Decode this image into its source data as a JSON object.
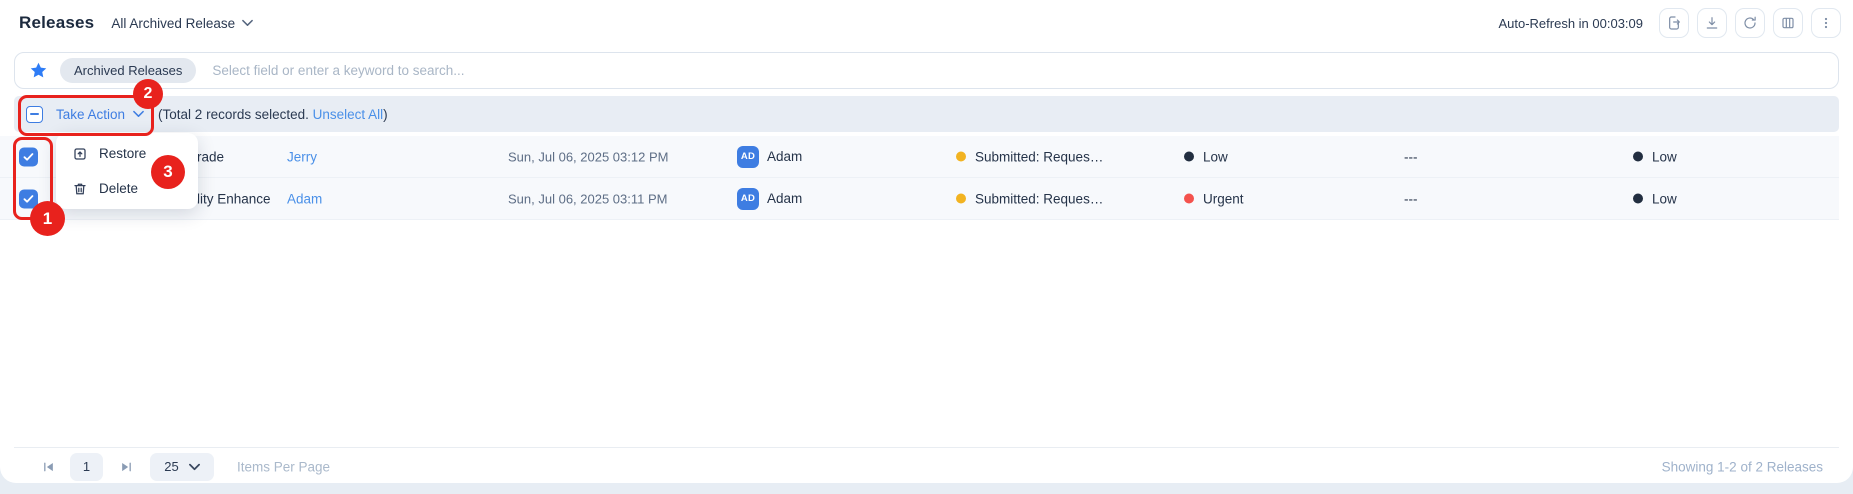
{
  "header": {
    "title": "Releases",
    "view_selector": "All Archived Release",
    "auto_refresh": "Auto-Refresh in 00:03:09",
    "toolbar_icons": [
      "export-icon",
      "download-icon",
      "refresh-icon",
      "columns-icon",
      "kebab-menu-icon"
    ]
  },
  "search": {
    "star_icon": "favorite-star-icon",
    "chip": "Archived Releases",
    "placeholder": "Select field or enter a keyword to search..."
  },
  "action_bar": {
    "take_action_label": "Take Action",
    "selection_prefix": "(Total 2 records selected. ",
    "unselect_all": "Unselect All",
    "selection_suffix": ")"
  },
  "menu": {
    "items": [
      {
        "label": "Restore",
        "icon": "restore-icon"
      },
      {
        "label": "Delete",
        "icon": "trash-icon"
      }
    ]
  },
  "table": {
    "rows": [
      {
        "name_fragment": "rade",
        "requester": "Jerry",
        "date": "Sun, Jul 06, 2025 03:12 PM",
        "assignee_initials": "AD",
        "assignee": "Adam",
        "status": "Submitted: Reques…",
        "status_color": "#f2b321",
        "priority": "Low",
        "priority_color": "#222e40",
        "placeholder_value": "---",
        "risk": "Low",
        "risk_color": "#222e40"
      },
      {
        "name_fragment": "lity Enhance",
        "requester": "Adam",
        "date": "Sun, Jul 06, 2025 03:11 PM",
        "assignee_initials": "AD",
        "assignee": "Adam",
        "status": "Submitted: Reques…",
        "status_color": "#f2b321",
        "priority": "Urgent",
        "priority_color": "#f4524d",
        "placeholder_value": "---",
        "risk": "Low",
        "risk_color": "#222e40"
      }
    ]
  },
  "pagination": {
    "current_page": "1",
    "page_size": "25",
    "items_per_page_label": "Items Per Page",
    "summary": "Showing 1-2 of 2 Releases"
  },
  "annotations": {
    "step1": "1",
    "step2": "2",
    "step3": "3",
    "color": "#e8221d"
  },
  "colors": {
    "accent_blue": "#3e7de2",
    "link_blue": "#4a90e8",
    "status_yellow": "#f2b321",
    "priority_urgent_red": "#f4524d",
    "priority_low_black": "#222e40"
  }
}
